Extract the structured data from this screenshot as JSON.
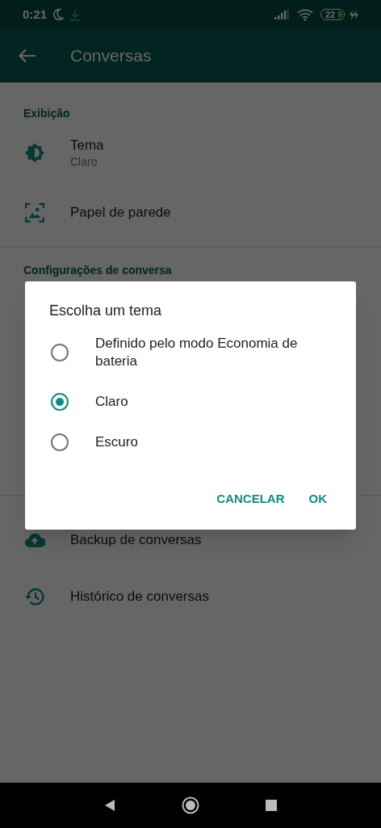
{
  "status_bar": {
    "time": "0:21",
    "battery": "22"
  },
  "app_bar": {
    "title": "Conversas"
  },
  "sections": [
    {
      "heading": "Exibição",
      "items": [
        {
          "kind": "theme",
          "title": "Tema",
          "subtitle": "Claro"
        },
        {
          "kind": "wallpaper",
          "title": "Papel de parede"
        }
      ]
    },
    {
      "heading": "Configurações de conversa"
    },
    {
      "items": [
        {
          "kind": "backup",
          "title": "Backup de conversas"
        },
        {
          "kind": "history",
          "title": "Histórico de conversas"
        }
      ]
    }
  ],
  "dialog": {
    "title": "Escolha um tema",
    "options": [
      {
        "label": "Definido pelo modo Economia de bateria",
        "selected": false
      },
      {
        "label": "Claro",
        "selected": true
      },
      {
        "label": "Escuro",
        "selected": false
      }
    ],
    "buttons": [
      "CANCELAR",
      "OK"
    ]
  }
}
